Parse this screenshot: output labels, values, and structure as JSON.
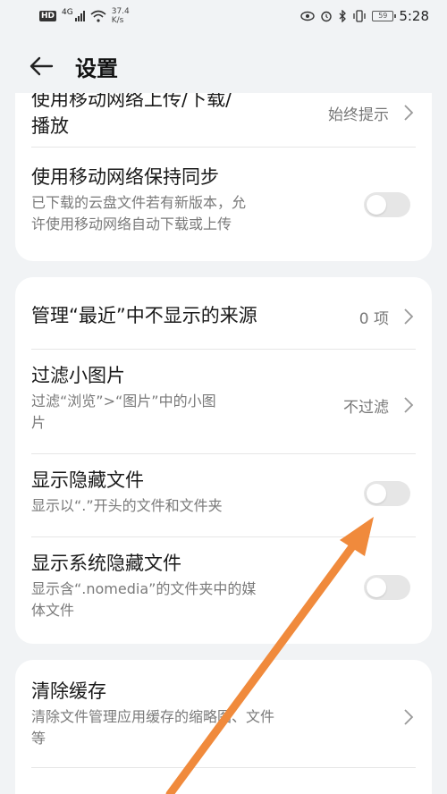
{
  "status": {
    "hd": "HD",
    "network_gen": "4G",
    "net_speed_value": "37.4",
    "net_speed_unit": "K/s",
    "battery": "59",
    "time": "5:28"
  },
  "header": {
    "title": "设置"
  },
  "card1": {
    "row_upload": {
      "title_line1": "使用移动网络上传/下载/",
      "title_line2": "播放",
      "value": "始终提示"
    },
    "row_sync": {
      "title": "使用移动网络保持同步",
      "sub_line1": "已下载的云盘文件若有新版本，允",
      "sub_line2": "许使用移动网络自动下载或上传",
      "enabled": false
    }
  },
  "card2": {
    "row_recent": {
      "title": "管理“最近”中不显示的来源",
      "value": "0 项"
    },
    "row_filter": {
      "title": "过滤小图片",
      "sub_line1": "过滤“浏览”>“图片”中的小图",
      "sub_line2": "片",
      "value": "不过滤"
    },
    "row_hidden": {
      "title": "显示隐藏文件",
      "sub": "显示以“.”开头的文件和文件夹",
      "enabled": false
    },
    "row_sys_hidden": {
      "title": "显示系统隐藏文件",
      "sub_line1": "显示含“.nomedia”的文件夹中的媒",
      "sub_line2": "体文件",
      "enabled": false
    }
  },
  "card3": {
    "row_cache": {
      "title": "清除缓存",
      "sub_line1": "清除文件管理应用缓存的缩略图、文件",
      "sub_line2": "等"
    }
  },
  "colors": {
    "background": "#f1f3f5",
    "card": "#ffffff",
    "toggle_off": "#e6e6e6",
    "annotation_arrow": "#f08a3c"
  }
}
